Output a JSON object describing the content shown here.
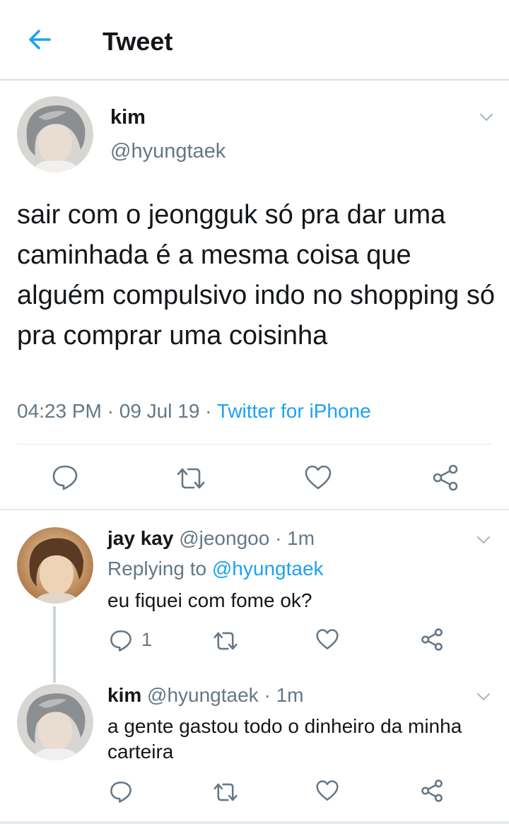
{
  "header": {
    "title": "Tweet"
  },
  "main_tweet": {
    "name": "kim",
    "handle": "@hyungtaek",
    "text": "sair com o jeongguk só pra dar uma caminhada é a mesma coisa que alguém compulsivo indo no shopping só pra comprar uma coisinha",
    "time": "04:23 PM",
    "sep": "·",
    "date": "09 Jul 19",
    "source": "Twitter for iPhone"
  },
  "replies": [
    {
      "name": "jay kay",
      "handle": "@jeongoo",
      "sep": "·",
      "age": "1m",
      "replying_prefix": "Replying to",
      "replying_handle": "@hyungtaek",
      "text": "eu fiquei com fome ok?",
      "reply_count": "1"
    },
    {
      "name": "kim",
      "handle": "@hyungtaek",
      "sep": "·",
      "age": "1m",
      "text": "a gente gastou todo o dinheiro da minha carteira"
    }
  ],
  "colors": {
    "accent": "#1da1f2",
    "muted": "#657786",
    "text": "#14171a",
    "divider": "#e1e8ed"
  },
  "icons": [
    "back-arrow-icon",
    "chevron-down-icon",
    "reply-icon",
    "retweet-icon",
    "like-icon",
    "share-icon"
  ]
}
